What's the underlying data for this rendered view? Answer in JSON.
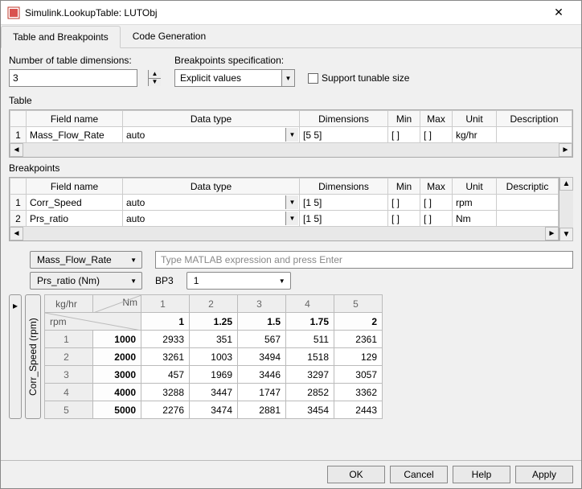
{
  "window_title": "Simulink.LookupTable: LUTObj",
  "tabs": [
    "Table and Breakpoints",
    "Code Generation"
  ],
  "active_tab": 0,
  "num_dims_label": "Number of table dimensions:",
  "num_dims_value": "3",
  "bp_spec_label": "Breakpoints specification:",
  "bp_spec_value": "Explicit values",
  "support_tunable_label": "Support tunable size",
  "table_label": "Table",
  "breakpoints_label": "Breakpoints",
  "cols": {
    "fieldname": "Field name",
    "datatype": "Data type",
    "dimensions": "Dimensions",
    "min": "Min",
    "max": "Max",
    "unit": "Unit",
    "description": "Description",
    "description_trunc": "Descriptic"
  },
  "table_rows": [
    {
      "n": "1",
      "field": "Mass_Flow_Rate",
      "dtype": "auto",
      "dims": "[5 5]",
      "min": "[ ]",
      "max": "[ ]",
      "unit": "kg/hr",
      "desc": ""
    }
  ],
  "bp_rows": [
    {
      "n": "1",
      "field": "Corr_Speed",
      "dtype": "auto",
      "dims": "[1 5]",
      "min": "[ ]",
      "max": "[ ]",
      "unit": "rpm",
      "desc": ""
    },
    {
      "n": "2",
      "field": "Prs_ratio",
      "dtype": "auto",
      "dims": "[1 5]",
      "min": "[ ]",
      "max": "[ ]",
      "unit": "Nm",
      "desc": ""
    }
  ],
  "view": {
    "row_selector": "Mass_Flow_Rate",
    "expr_placeholder": "Type MATLAB expression and press Enter",
    "slice_selector": "Prs_ratio (Nm)",
    "bp3_label": "BP3",
    "bp3_value": "1"
  },
  "data_grid": {
    "corner_top": "kg/hr",
    "corner_right": "Nm",
    "corner_bottom": "rpm",
    "side_label": "Corr_Speed (rpm)",
    "col_nums": [
      "1",
      "2",
      "3",
      "4",
      "5"
    ],
    "col_bp": [
      "1",
      "1.25",
      "1.5",
      "1.75",
      "2"
    ],
    "row_nums": [
      "1",
      "2",
      "3",
      "4",
      "5"
    ],
    "row_bp": [
      "1000",
      "2000",
      "3000",
      "4000",
      "5000"
    ],
    "cells": [
      [
        "2933",
        "351",
        "567",
        "511",
        "2361"
      ],
      [
        "3261",
        "1003",
        "3494",
        "1518",
        "129"
      ],
      [
        "457",
        "1969",
        "3446",
        "3297",
        "3057"
      ],
      [
        "3288",
        "3447",
        "1747",
        "2852",
        "3362"
      ],
      [
        "2276",
        "3474",
        "2881",
        "3454",
        "2443"
      ]
    ]
  },
  "buttons": {
    "ok": "OK",
    "cancel": "Cancel",
    "help": "Help",
    "apply": "Apply"
  }
}
